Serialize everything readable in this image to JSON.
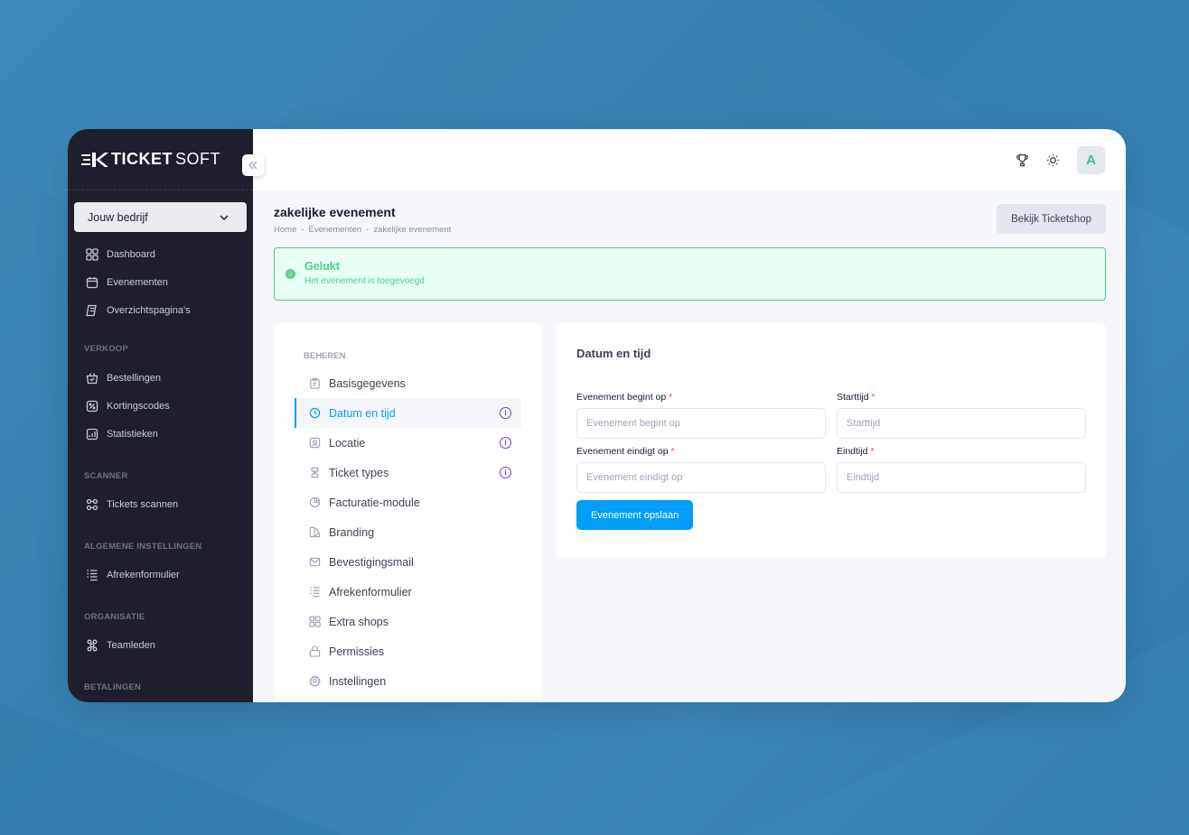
{
  "brand": {
    "logo_bold": "TICKET",
    "logo_light": "SOFT"
  },
  "sidebar": {
    "company": "Jouw bedrijf",
    "items": [
      {
        "label": "Dashboard",
        "icon": "grid-icon"
      },
      {
        "label": "Evenementen",
        "icon": "calendar-icon"
      },
      {
        "label": "Overzichtspagina's",
        "icon": "pages-icon"
      }
    ],
    "sections": {
      "verkoop": "VERKOOP",
      "scanner": "SCANNER",
      "algemene": "ALGEMENE INSTELLINGEN",
      "organisatie": "ORGANISATIE",
      "betalingen": "BETALINGEN"
    },
    "verkoop_items": [
      "Bestellingen",
      "Kortingscodes",
      "Statistieken"
    ],
    "scanner_items": [
      "Tickets scannen"
    ],
    "algemene_items": [
      "Afrekenformulier"
    ],
    "organisatie_items": [
      "Teamleden"
    ]
  },
  "topbar": {
    "avatar_letter": "A"
  },
  "page": {
    "title": "zakelijke evenement",
    "breadcrumb": [
      "Home",
      "-",
      "Evenementen",
      "-",
      "zakelijke evenement"
    ],
    "ticketshop_button": "Bekijk Ticketshop"
  },
  "alert": {
    "title": "Gelukt",
    "text": "Het evenement is toegevoegd"
  },
  "manage": {
    "title": "BEHEREN",
    "items": [
      "Basisgegevens",
      "Datum en tijd",
      "Locatie",
      "Ticket types",
      "Facturatie-module",
      "Branding",
      "Bevestigingsmail",
      "Afrekenformulier",
      "Extra shops",
      "Permissies",
      "Instellingen"
    ]
  },
  "form": {
    "title": "Datum en tijd",
    "start_date_label": "Evenement begint op",
    "start_date_placeholder": "Evenement begint op",
    "start_time_label": "Starttijd",
    "start_time_placeholder": "Starttijd",
    "end_date_label": "Evenement eindigt op",
    "end_date_placeholder": "Evenement eindigt op",
    "end_time_label": "Eindtijd",
    "end_time_placeholder": "Eindtijd",
    "required_mark": "*",
    "save_label": "Evenement opslaan"
  },
  "colors": {
    "accent": "#009ef7",
    "success": "#50cd89",
    "sidebar": "#1e1e2d",
    "info": "#7239ea"
  }
}
